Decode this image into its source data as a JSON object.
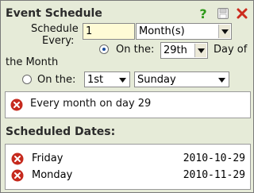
{
  "header": {
    "title": "Event Schedule",
    "help_icon": "help-icon",
    "save_icon": "save-icon",
    "close_icon": "close-icon"
  },
  "form": {
    "schedule_every_label_line1": "Schedule",
    "schedule_every_label_line2": "Every:",
    "interval_value": "1",
    "interval_unit": "Month(s)",
    "option1": {
      "label_prefix": "On the:",
      "day_value": "29th",
      "label_suffix_line1": "Day of",
      "label_suffix_line2": "the Month",
      "selected": true
    },
    "option2": {
      "label_prefix": "On the:",
      "ordinal_value": "1st",
      "weekday_value": "Sunday",
      "selected": false
    }
  },
  "summary": {
    "text": "Every month on day 29"
  },
  "scheduled": {
    "title": "Scheduled Dates:",
    "items": [
      {
        "day": "Friday",
        "date": "2010-10-29"
      },
      {
        "day": "Monday",
        "date": "2010-11-29"
      }
    ]
  },
  "colors": {
    "panel_bg": "#e6ebd8",
    "input_bg": "#fffbd6",
    "help_green": "#2e9a1a",
    "close_red": "#cc2b1d",
    "error_red": "#c62a1e"
  }
}
